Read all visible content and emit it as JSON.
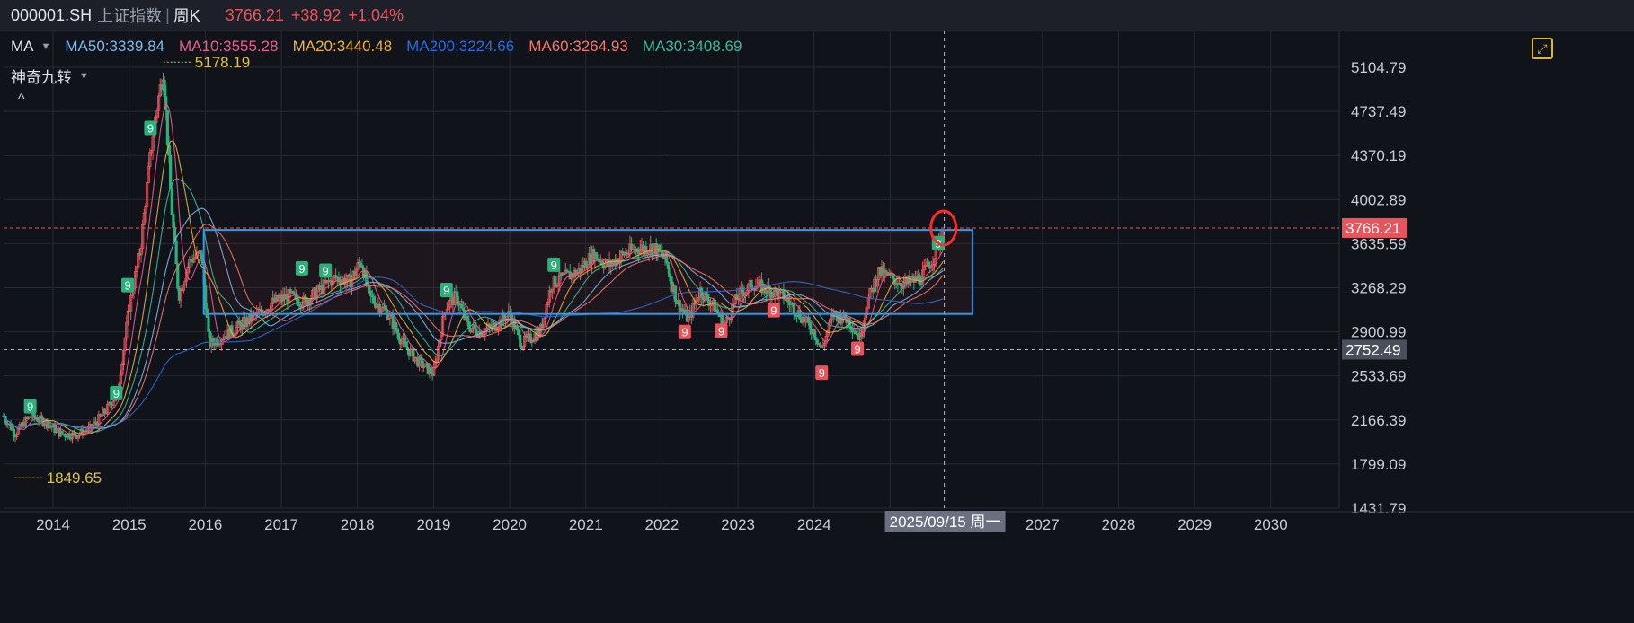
{
  "header": {
    "code": "000001.SH",
    "name": "上证指数",
    "separator": "|",
    "period": "周K",
    "price": "3766.21",
    "change": "+38.92",
    "change_pct": "+1.04%"
  },
  "legend": {
    "ma_selector": "MA",
    "indicator_selector": "神奇九转",
    "ma_items": [
      {
        "label": "MA50:3339.84",
        "color": "#7fb6e8"
      },
      {
        "label": "MA10:3555.28",
        "color": "#e85d8a"
      },
      {
        "label": "MA20:3440.48",
        "color": "#e8b43a"
      },
      {
        "label": "MA200:3224.66",
        "color": "#2f6ad6"
      },
      {
        "label": "MA60:3264.93",
        "color": "#f0786a"
      },
      {
        "label": "MA30:3408.69",
        "color": "#3ab89a"
      }
    ]
  },
  "colors": {
    "up": "#e8545c",
    "down": "#2ab07a",
    "box": "#2d9be8",
    "price_line": "#e8545c",
    "crosshair": "#b0b4bc",
    "annotation": "#e0c33a",
    "circle": "#ff2a2a"
  },
  "icons": {
    "expand": "expand-icon",
    "collapse": "chevron-up-icon",
    "dropdown": "caret-down-icon"
  },
  "chart_data": {
    "type": "candlestick",
    "symbol": "000001.SH",
    "period": "weekly",
    "x_range": [
      2013.35,
      2030.9
    ],
    "ylim": [
      1431.79,
      5300
    ],
    "y_ticks": [
      "5104.79",
      "4737.49",
      "4370.19",
      "4002.89",
      "3635.59",
      "3268.29",
      "2900.99",
      "2533.69",
      "2166.39",
      "1799.09",
      "1431.79"
    ],
    "x_ticks": [
      "2014",
      "2015",
      "2016",
      "2017",
      "2018",
      "2019",
      "2020",
      "2021",
      "2022",
      "2023",
      "2024",
      "2",
      "2027",
      "2028",
      "2029",
      "2030"
    ],
    "x_tick_years": [
      2014,
      2015,
      2016,
      2017,
      2018,
      2019,
      2020,
      2021,
      2022,
      2023,
      2024,
      2025,
      2027,
      2028,
      2029,
      2030
    ],
    "current_price": {
      "label": "3766.21",
      "value": 3766.21
    },
    "crosshair": {
      "date_label": "2025/09/15 周一",
      "x": 2025.71,
      "y_label": "2752.49",
      "y": 2752.49
    },
    "high_marker": {
      "label": "5178.19",
      "x": 2015.45,
      "y": 5178.19
    },
    "low_marker": {
      "label": "1849.65",
      "x": 2013.5,
      "y": 1849.65
    },
    "box": {
      "x0": 2015.98,
      "x1": 2026.08,
      "y0": 3050,
      "y1": 3750
    },
    "nine_signals": [
      {
        "label": "9",
        "x": 2013.7,
        "y": 2280,
        "kind": "sell"
      },
      {
        "label": "9",
        "x": 2014.83,
        "y": 2390,
        "kind": "sell"
      },
      {
        "label": "9",
        "x": 2014.98,
        "y": 3290,
        "kind": "sell"
      },
      {
        "label": "9",
        "x": 2015.28,
        "y": 4600,
        "kind": "sell"
      },
      {
        "label": "9",
        "x": 2017.27,
        "y": 3430,
        "kind": "sell"
      },
      {
        "label": "9",
        "x": 2017.58,
        "y": 3410,
        "kind": "sell"
      },
      {
        "label": "9",
        "x": 2019.17,
        "y": 3250,
        "kind": "sell"
      },
      {
        "label": "9",
        "x": 2020.58,
        "y": 3460,
        "kind": "sell"
      },
      {
        "label": "9",
        "x": 2022.3,
        "y": 2900,
        "kind": "buy"
      },
      {
        "label": "9",
        "x": 2022.78,
        "y": 2910,
        "kind": "buy"
      },
      {
        "label": "9",
        "x": 2023.47,
        "y": 3080,
        "kind": "buy"
      },
      {
        "label": "9",
        "x": 2024.1,
        "y": 2560,
        "kind": "buy"
      },
      {
        "label": "9",
        "x": 2024.57,
        "y": 2760,
        "kind": "buy"
      },
      {
        "label": "9",
        "x": 2025.63,
        "y": 3640,
        "kind": "sell"
      }
    ],
    "price_path": [
      [
        2013.35,
        2200
      ],
      [
        2013.5,
        2050
      ],
      [
        2013.7,
        2200
      ],
      [
        2013.9,
        2150
      ],
      [
        2014.1,
        2050
      ],
      [
        2014.3,
        2040
      ],
      [
        2014.5,
        2100
      ],
      [
        2014.7,
        2250
      ],
      [
        2014.85,
        2400
      ],
      [
        2015.0,
        3100
      ],
      [
        2015.15,
        3600
      ],
      [
        2015.3,
        4500
      ],
      [
        2015.45,
        5100
      ],
      [
        2015.55,
        4000
      ],
      [
        2015.65,
        3200
      ],
      [
        2015.8,
        3500
      ],
      [
        2015.95,
        3550
      ],
      [
        2016.05,
        2800
      ],
      [
        2016.2,
        2850
      ],
      [
        2016.45,
        2950
      ],
      [
        2016.7,
        3050
      ],
      [
        2016.9,
        3150
      ],
      [
        2017.1,
        3200
      ],
      [
        2017.3,
        3150
      ],
      [
        2017.5,
        3250
      ],
      [
        2017.7,
        3350
      ],
      [
        2017.9,
        3320
      ],
      [
        2018.05,
        3500
      ],
      [
        2018.15,
        3200
      ],
      [
        2018.4,
        3050
      ],
      [
        2018.6,
        2800
      ],
      [
        2018.8,
        2650
      ],
      [
        2019.0,
        2550
      ],
      [
        2019.15,
        3100
      ],
      [
        2019.3,
        3200
      ],
      [
        2019.45,
        2950
      ],
      [
        2019.6,
        2900
      ],
      [
        2019.8,
        2950
      ],
      [
        2020.0,
        3050
      ],
      [
        2020.15,
        2800
      ],
      [
        2020.4,
        2900
      ],
      [
        2020.55,
        3300
      ],
      [
        2020.7,
        3350
      ],
      [
        2020.9,
        3400
      ],
      [
        2021.1,
        3550
      ],
      [
        2021.3,
        3450
      ],
      [
        2021.5,
        3550
      ],
      [
        2021.7,
        3600
      ],
      [
        2021.9,
        3600
      ],
      [
        2022.05,
        3500
      ],
      [
        2022.2,
        3150
      ],
      [
        2022.35,
        3000
      ],
      [
        2022.5,
        3250
      ],
      [
        2022.7,
        3100
      ],
      [
        2022.82,
        2950
      ],
      [
        2023.0,
        3200
      ],
      [
        2023.2,
        3300
      ],
      [
        2023.4,
        3250
      ],
      [
        2023.6,
        3200
      ],
      [
        2023.8,
        3050
      ],
      [
        2024.0,
        2900
      ],
      [
        2024.1,
        2750
      ],
      [
        2024.25,
        3050
      ],
      [
        2024.45,
        3000
      ],
      [
        2024.6,
        2850
      ],
      [
        2024.7,
        3150
      ],
      [
        2024.85,
        3400
      ],
      [
        2025.0,
        3350
      ],
      [
        2025.2,
        3300
      ],
      [
        2025.4,
        3350
      ],
      [
        2025.55,
        3500
      ],
      [
        2025.7,
        3766.21
      ]
    ],
    "ma_series": [
      {
        "name": "MA10",
        "color": "#e85d8a",
        "smooth": 2
      },
      {
        "name": "MA20",
        "color": "#e8b43a",
        "smooth": 4
      },
      {
        "name": "MA30",
        "color": "#3ab89a",
        "smooth": 6
      },
      {
        "name": "MA50",
        "color": "#7fb6e8",
        "smooth": 9
      },
      {
        "name": "MA60",
        "color": "#f0786a",
        "smooth": 11
      },
      {
        "name": "MA200",
        "color": "#2f6ad6",
        "smooth": 34
      }
    ]
  }
}
